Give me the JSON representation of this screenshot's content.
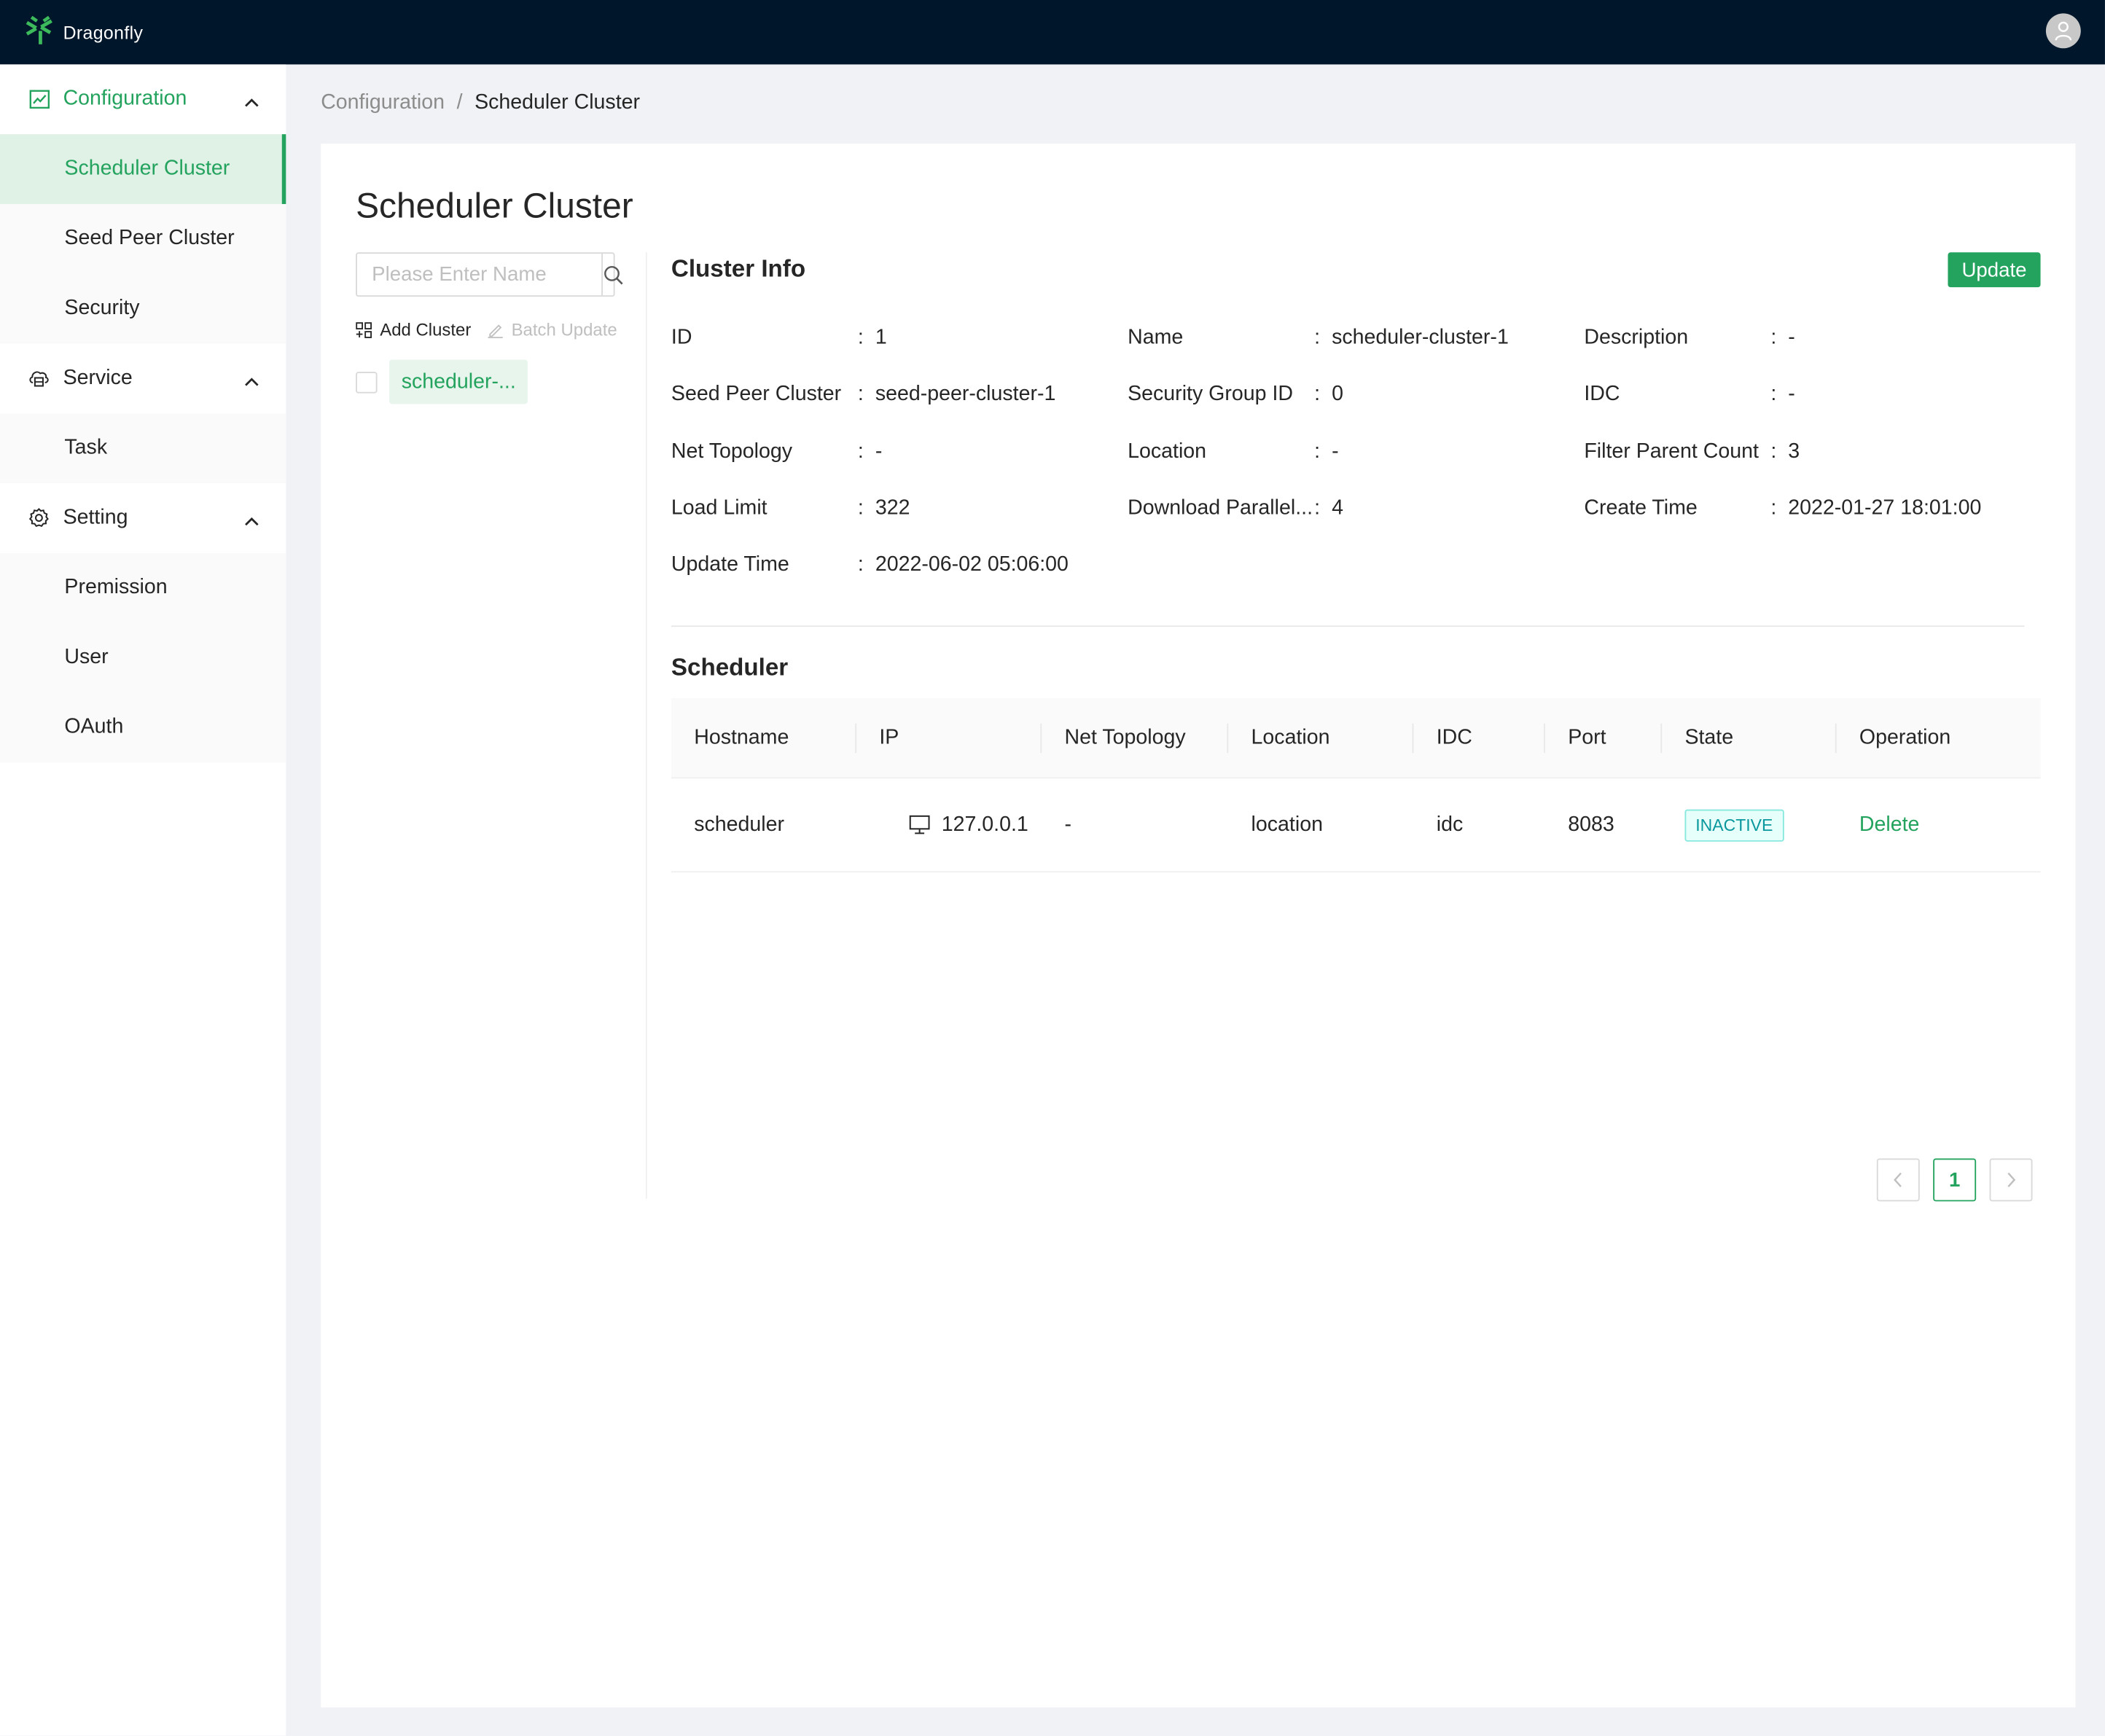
{
  "app": {
    "name": "Dragonfly"
  },
  "sidebar": {
    "groups": [
      {
        "label": "Configuration",
        "icon": "chart-line-icon",
        "active": true,
        "items": [
          {
            "label": "Scheduler Cluster",
            "selected": true
          },
          {
            "label": "Seed Peer Cluster"
          },
          {
            "label": "Security"
          }
        ]
      },
      {
        "label": "Service",
        "icon": "cloud-server-icon",
        "items": [
          {
            "label": "Task"
          }
        ]
      },
      {
        "label": "Setting",
        "icon": "gear-icon",
        "items": [
          {
            "label": "Premission"
          },
          {
            "label": "User"
          },
          {
            "label": "OAuth"
          }
        ]
      }
    ]
  },
  "breadcrumb": {
    "parent": "Configuration",
    "separator": "/",
    "current": "Scheduler Cluster"
  },
  "page": {
    "title": "Scheduler Cluster",
    "search": {
      "placeholder": "Please Enter Name",
      "value": ""
    },
    "actions": {
      "add": "Add Cluster",
      "batch": "Batch Update"
    },
    "clusters": [
      {
        "label": "scheduler-..."
      }
    ]
  },
  "cluster_info": {
    "title": "Cluster Info",
    "update_label": "Update",
    "separator": ":",
    "fields": [
      {
        "label": "ID",
        "value": "1"
      },
      {
        "label": "Name",
        "value": "scheduler-cluster-1"
      },
      {
        "label": "Description",
        "value": "-"
      },
      {
        "label": "Seed Peer Cluster",
        "value": "seed-peer-cluster-1"
      },
      {
        "label": "Security Group ID",
        "value": "0"
      },
      {
        "label": "IDC",
        "value": "-"
      },
      {
        "label": "Net Topology",
        "value": "-"
      },
      {
        "label": "Location",
        "value": "-"
      },
      {
        "label": "Filter Parent Count",
        "value": "3"
      },
      {
        "label": "Load Limit",
        "value": "322"
      },
      {
        "label": "Download Parallel...",
        "value": "4"
      },
      {
        "label": "Create Time",
        "value": "2022-01-27 18:01:00"
      },
      {
        "label": "Update Time",
        "value": "2022-06-02 05:06:00"
      }
    ]
  },
  "scheduler": {
    "title": "Scheduler",
    "columns": [
      "Hostname",
      "IP",
      "Net Topology",
      "Location",
      "IDC",
      "Port",
      "State",
      "Operation"
    ],
    "rows": [
      {
        "hostname": "scheduler",
        "ip": "127.0.0.1",
        "net_topology": "-",
        "location": "location",
        "idc": "idc",
        "port": "8083",
        "state": "INACTIVE",
        "operation": "Delete"
      }
    ],
    "pagination": {
      "current": "1"
    }
  },
  "colors": {
    "accent": "#23a35d",
    "topbar": "#00162b",
    "state_inactive": "#08979c"
  }
}
